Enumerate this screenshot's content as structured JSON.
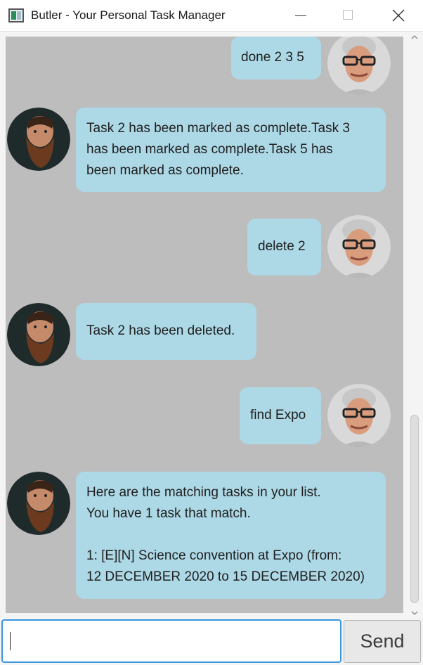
{
  "window": {
    "title": "Butler - Your Personal Task Manager"
  },
  "icons": {
    "app": "app-icon",
    "minimize": "minimize-icon",
    "maximize": "maximize-icon",
    "close": "close-icon",
    "user_avatar": "user-avatar",
    "butler_avatar": "butler-avatar"
  },
  "colors": {
    "bubble": "#add8e6",
    "dialog_background": "#bdbdbd",
    "input_focus": "#3a96dd"
  },
  "messages": [
    {
      "sender": "user",
      "lines": [
        "done 2 3 5"
      ]
    },
    {
      "sender": "butler",
      "lines": [
        "Task 2 has been marked as complete.Task 3",
        "has been marked as complete.Task 5 has",
        "been marked as complete."
      ]
    },
    {
      "sender": "user",
      "lines": [
        "delete 2"
      ]
    },
    {
      "sender": "butler",
      "lines": [
        "Task 2 has been deleted."
      ]
    },
    {
      "sender": "user",
      "lines": [
        "find Expo"
      ]
    },
    {
      "sender": "butler",
      "lines": [
        "Here are the matching tasks in your list.",
        "You have 1 task that match.",
        "",
        "1: [E][N] Science convention at Expo (from:",
        "12 DECEMBER 2020 to 15 DECEMBER 2020)"
      ]
    }
  ],
  "input": {
    "value": "",
    "placeholder": ""
  },
  "send_button": {
    "label": "Send"
  }
}
